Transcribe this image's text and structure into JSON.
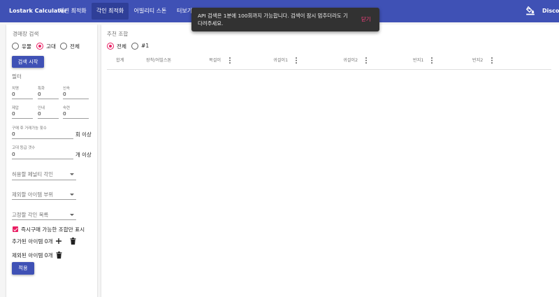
{
  "app": {
    "brand": "Lostark Calculator",
    "tabs": [
      {
        "label": "재련 최적화"
      },
      {
        "label": "각인 최적화"
      },
      {
        "label": "어빌리티 스톤"
      },
      {
        "label": "터보기"
      }
    ],
    "discord": "Discord"
  },
  "snackbar": {
    "message": "API 검색은 1분에 100회까지 가능합니다. 검색이 잠시 멈추더라도 기다려주세요.",
    "close_label": "닫기"
  },
  "search": {
    "title": "경매장 검색",
    "options": [
      {
        "label": "유물",
        "selected": false
      },
      {
        "label": "고대",
        "selected": true
      },
      {
        "label": "전체",
        "selected": false
      }
    ],
    "start_label": "검색 시작"
  },
  "filter": {
    "title": "필터",
    "stats": [
      {
        "label": "치명",
        "value": "0"
      },
      {
        "label": "특화",
        "value": "0"
      },
      {
        "label": "신속",
        "value": "0"
      },
      {
        "label": "제압",
        "value": "0"
      },
      {
        "label": "인내",
        "value": "0"
      },
      {
        "label": "숙련",
        "value": "0"
      }
    ],
    "trade_label": "구매 후 거래가능 횟수",
    "trade_value": "0",
    "trade_suffix": "회 이상",
    "quality_label": "고대 등급 갯수",
    "quality_value": "0",
    "quality_suffix": "개 이상",
    "penalty_label": "허용할 페널티 각인",
    "exclude_part_label": "제외할 아이템 부위",
    "fixed_label": "고정할 각인 목록",
    "buy_now_label": "즉시구매 가능한 조합만 표시",
    "buy_now_checked": true,
    "added_items": "추가된 아이템 0개",
    "excluded_items": "제외된 아이템 0개",
    "apply_label": "적용"
  },
  "results": {
    "title": "추천 조합",
    "options": [
      {
        "label": "전체",
        "selected": true
      },
      {
        "label": "#1",
        "selected": false
      }
    ],
    "columns": [
      "합계",
      "장착/어빌스톤",
      "목걸이",
      "귀걸이1",
      "귀걸이2",
      "반지1",
      "반지2"
    ]
  },
  "colors": {
    "primary": "#3f51b5",
    "accent": "#e91e63",
    "snackbar": "#323232"
  }
}
